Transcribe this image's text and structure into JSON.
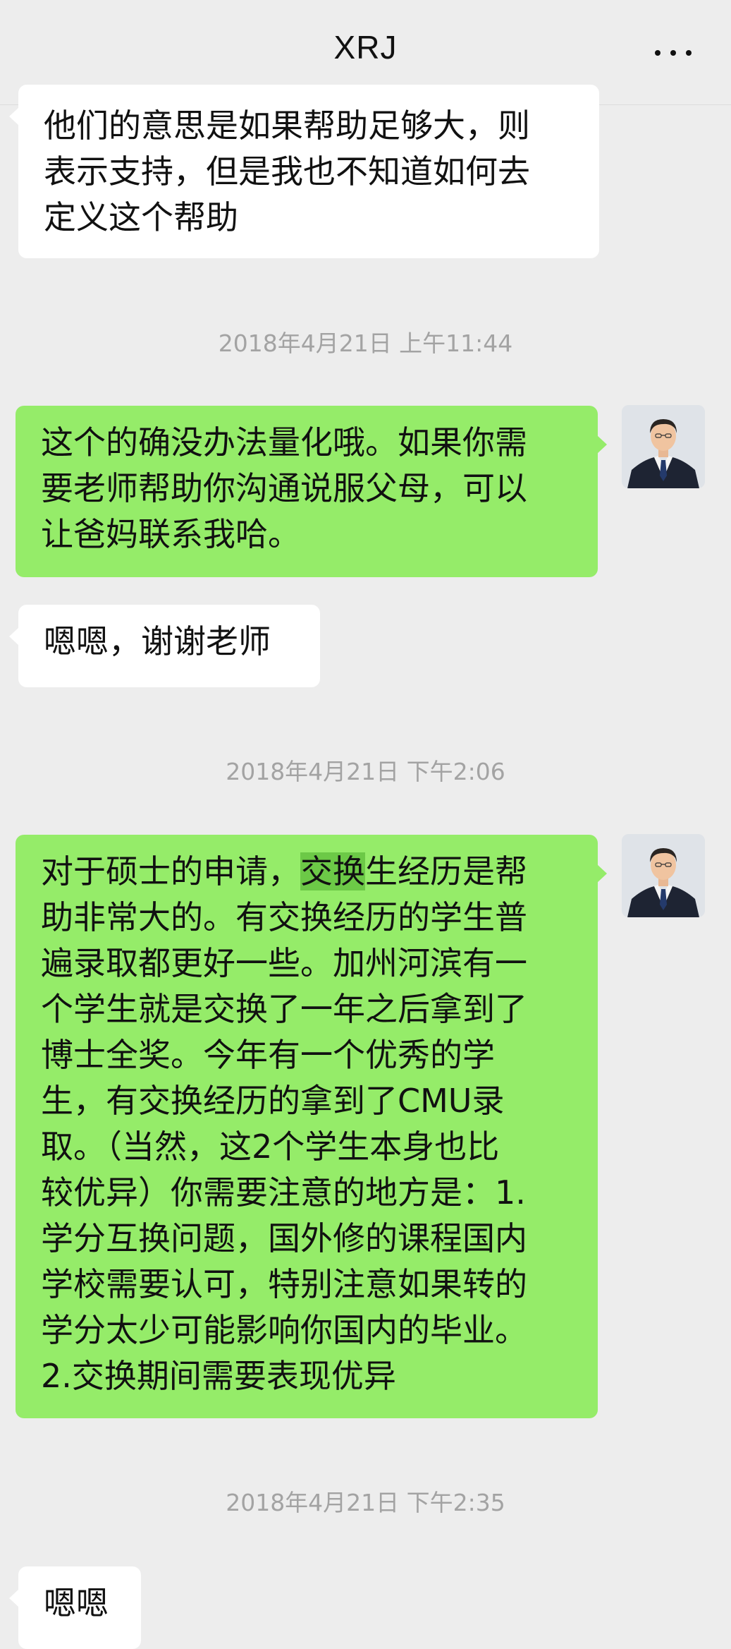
{
  "header": {
    "title": "XRJ",
    "more_icon": "more-dots-icon"
  },
  "colors": {
    "background": "#ededed",
    "incoming_bubble": "#ffffff",
    "outgoing_bubble": "#95ec69",
    "timestamp": "#a3a3a3",
    "highlight": "#6cc947"
  },
  "messages": [
    {
      "sender": "contact",
      "lines": [
        "他们的意思是如果帮助足够大，则",
        "表示支持，但是我也不知道如何去",
        "定义这个帮助"
      ]
    },
    {
      "sender": "me",
      "avatar": "teacher-avatar",
      "lines": [
        "这个的确没办法量化哦。如果你需",
        "要老师帮助你沟通说服父母，可以",
        "让爸妈联系我哈。"
      ]
    },
    {
      "sender": "contact",
      "lines": [
        "嗯嗯，谢谢老师"
      ]
    },
    {
      "sender": "me",
      "avatar": "teacher-avatar",
      "first_line_before": "对于硕士的申请，",
      "first_line_highlight": "交换",
      "first_line_after": "生经历是帮",
      "lines": [
        "助非常大的。有交换经历的学生普",
        "遍录取都更好一些。加州河滨有一",
        "个学生就是交换了一年之后拿到了",
        "博士全奖。今年有一个优秀的学",
        "生，有交换经历的拿到了CMU录",
        "取。（当然，这2个学生本身也比",
        "较优异）你需要注意的地方是：1.",
        "学分互换问题，国外修的课程国内",
        "学校需要认可，特别注意如果转的",
        "学分太少可能影响你国内的毕业。",
        "2.交换期间需要表现优异"
      ]
    },
    {
      "sender": "contact",
      "lines": [
        "嗯嗯"
      ]
    }
  ],
  "timestamps": [
    "2018年4月21日 上午11:44",
    "2018年4月21日 下午2:06",
    "2018年4月21日 下午2:35"
  ]
}
